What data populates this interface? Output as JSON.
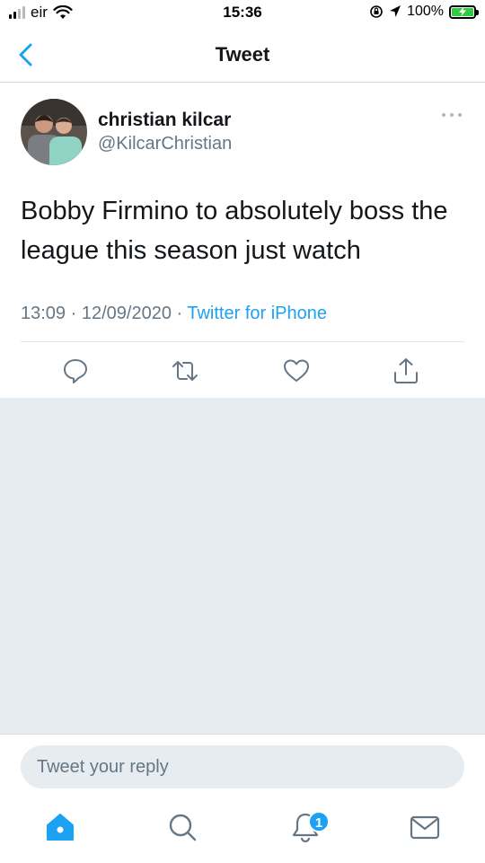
{
  "status_bar": {
    "carrier": "eir",
    "time": "15:36",
    "battery": "100%"
  },
  "nav": {
    "title": "Tweet",
    "back_icon": "chevron-left-icon"
  },
  "tweet": {
    "author_name": "christian kilcar",
    "author_handle": "@KilcarChristian",
    "text": "Bobby Firmino to absolutely boss the league this season just watch",
    "time": "13:09",
    "date": "12/09/2020",
    "separator": " · ",
    "source": "Twitter for iPhone",
    "actions": [
      "reply-icon",
      "retweet-icon",
      "like-icon",
      "share-icon"
    ]
  },
  "reply": {
    "placeholder": "Tweet your reply"
  },
  "tabbar": {
    "items": [
      "home-icon",
      "search-icon",
      "notifications-icon",
      "messages-icon"
    ],
    "notification_count": "1"
  },
  "colors": {
    "accent": "#1da1f2",
    "text": "#14171a",
    "secondary": "#657786",
    "background_gray": "#e6ecf0"
  }
}
